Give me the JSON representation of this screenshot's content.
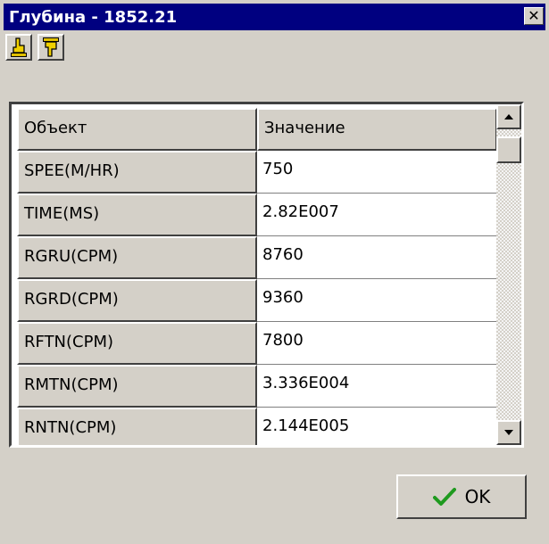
{
  "window": {
    "title": "Глубина - 1852.21",
    "close_glyph": "✕"
  },
  "toolbar": {
    "buttons": [
      {
        "icon": "hand-point-up-icon"
      },
      {
        "icon": "hand-point-down-icon"
      }
    ]
  },
  "grid": {
    "headers": [
      "Объект",
      "Значение"
    ],
    "rows": [
      {
        "object": "SPEE(M/HR)",
        "value": "750"
      },
      {
        "object": "TIME(MS)",
        "value": "2.82E007"
      },
      {
        "object": "RGRU(CPM)",
        "value": "8760"
      },
      {
        "object": "RGRD(CPM)",
        "value": "9360"
      },
      {
        "object": "RFTN(CPM)",
        "value": "7800"
      },
      {
        "object": "RMTN(CPM)",
        "value": "3.336E004"
      },
      {
        "object": "RNTN(CPM)",
        "value": "2.144E005"
      },
      {
        "object": "",
        "value": ""
      }
    ]
  },
  "footer": {
    "ok_label": "OK",
    "ok_icon": "checkmark-icon",
    "ok_icon_color": "#1f9a1f"
  }
}
